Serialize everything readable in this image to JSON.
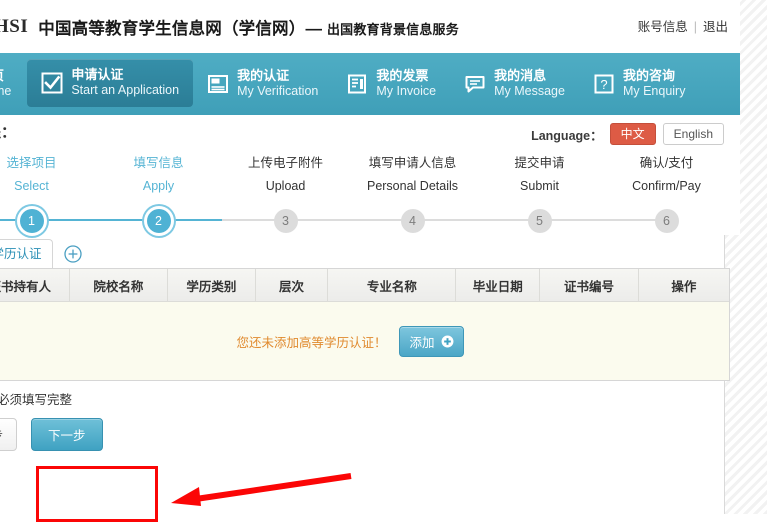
{
  "header": {
    "logo": "HSI",
    "title_cn": "中国高等教育学生信息网（学信网）—",
    "title_sub": "出国教育背景信息服务",
    "account_label": "账号信息",
    "separator": "|",
    "logout_label": "退出"
  },
  "nav": {
    "items": [
      {
        "cn": "首页",
        "en": "Home",
        "icon": "home-icon",
        "active": false
      },
      {
        "cn": "申请认证",
        "en": "Start an Application",
        "icon": "checkbox-icon",
        "active": true
      },
      {
        "cn": "我的认证",
        "en": "My Verification",
        "icon": "certificate-icon",
        "active": false
      },
      {
        "cn": "我的发票",
        "en": "My Invoice",
        "icon": "invoice-icon",
        "active": false
      },
      {
        "cn": "我的消息",
        "en": "My Message",
        "icon": "message-icon",
        "active": false
      },
      {
        "cn": "我的咨询",
        "en": "My Enquiry",
        "icon": "question-icon",
        "active": false
      }
    ]
  },
  "process": {
    "title": "程：",
    "language": {
      "label": "Language：",
      "zh_label": "中文",
      "en_label": "English",
      "selected": "中文",
      "active_color": "#dd5b45"
    },
    "steps": [
      {
        "num": "1",
        "cn": "选择项目",
        "en": "Select",
        "state": "done"
      },
      {
        "num": "2",
        "cn": "填写信息",
        "en": "Apply",
        "state": "done"
      },
      {
        "num": "3",
        "cn": "上传电子附件",
        "en": "Upload",
        "state": "todo"
      },
      {
        "num": "4",
        "cn": "填写申请人信息",
        "en": "Personal Details",
        "state": "todo"
      },
      {
        "num": "5",
        "cn": "提交申请",
        "en": "Submit",
        "state": "todo"
      },
      {
        "num": "6",
        "cn": "确认/支付",
        "en": "Confirm/Pay",
        "state": "todo"
      }
    ]
  },
  "tabs": {
    "active_tab": "等学历认证",
    "add_tab_icon": "plus-circle-icon"
  },
  "table": {
    "columns": [
      "证书持有人",
      "院校名称",
      "学历类别",
      "层次",
      "专业名称",
      "毕业日期",
      "证书编号",
      "操作"
    ],
    "empty_message": "您还未添加高等学历认证！",
    "add_button_label": "添加",
    "add_button_icon": "plus-circle-icon",
    "rows": []
  },
  "footer": {
    "note": "项目必须填写完整",
    "prev_label": "一步",
    "next_label": "下一步"
  },
  "annotation": {
    "highlight_color": "#fb0606",
    "arrow": "left-arrow"
  },
  "watermark": "　"
}
